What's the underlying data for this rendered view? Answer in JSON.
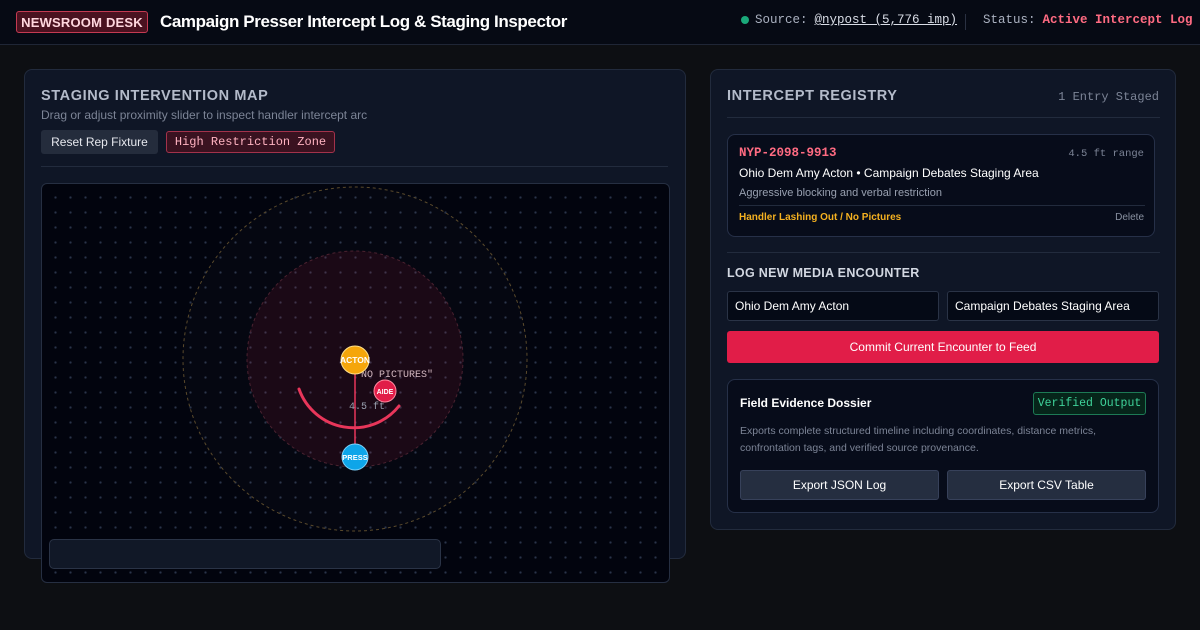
{
  "header": {
    "badge": "NEWSROOM DESK",
    "title": "Campaign Presser Intercept Log & Staging Inspector",
    "source_label": "Source:",
    "source_value": "@nypost (5,776 imp)",
    "status_label": "Status:",
    "status_value": "Active Intercept Log"
  },
  "map_panel": {
    "title": "STAGING INTERVENTION MAP",
    "subtitle": "Drag or adjust proximity slider to inspect handler intercept arc",
    "reset_button": "Reset Rep Fixture",
    "zone_chip": "High Restriction Zone",
    "markers": {
      "acton": "ACTON",
      "aide": "AIDE",
      "press": "PRESS"
    },
    "quote_label": "\"NO PICTURES\"",
    "distance_label": "4.5 ft"
  },
  "registry": {
    "title": "INTERCEPT REGISTRY",
    "count": "1 Entry Staged",
    "entries": [
      {
        "id": "NYP-2098-9913",
        "range": "4.5 ft range",
        "who_where": "Ohio Dem Amy Acton • Campaign Debates Staging Area",
        "description": "Aggressive blocking and verbal restriction",
        "tag": "Handler Lashing Out / No Pictures",
        "delete_label": "Delete"
      }
    ],
    "log_title": "LOG NEW MEDIA ENCOUNTER",
    "subject_value": "Ohio Dem Amy Acton",
    "location_value": "Campaign Debates Staging Area",
    "commit_button": "Commit Current Encounter to Feed",
    "dossier": {
      "title": "Field Evidence Dossier",
      "chip": "Verified Output",
      "description": "Exports complete structured timeline including coordinates, distance metrics, confrontation tags, and verified source provenance.",
      "export_json": "Export JSON Log",
      "export_csv": "Export CSV Table"
    }
  },
  "colors": {
    "accent": "#e11d48",
    "alert_text": "#ff6b82",
    "warning": "#f5b120",
    "verified": "#3fd39a",
    "press_marker": "#0ea5e9",
    "aide_marker": "#e11d48",
    "acton_marker": "#f5a60b"
  }
}
